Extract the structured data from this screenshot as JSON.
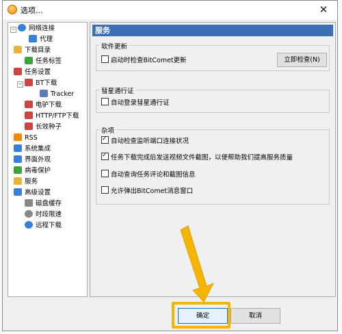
{
  "window": {
    "title": "选项...",
    "close_symbol": "✕"
  },
  "tree": [
    {
      "label": "网络连接",
      "icon": "globe-icon",
      "color": "#3a7fd6"
    },
    {
      "label": "代理",
      "icon": "proxy-icon",
      "color": "#3a7fd6"
    },
    {
      "label": "下载目录",
      "icon": "folder-icon",
      "color": "#e6b43c"
    },
    {
      "label": "任务标签",
      "icon": "tag-icon",
      "color": "#3ba33b"
    },
    {
      "label": "任务设置",
      "icon": "task-icon",
      "color": "#c44"
    },
    {
      "label": "BT下载",
      "icon": "bt-icon",
      "color": "#c44"
    },
    {
      "label": "Tracker",
      "icon": "tracker-icon",
      "color": "#5a7fb8"
    },
    {
      "label": "电驴下载",
      "icon": "ed2k-icon",
      "color": "#c44"
    },
    {
      "label": "HTTP/FTP下载",
      "icon": "http-icon",
      "color": "#c44"
    },
    {
      "label": "长效种子",
      "icon": "seed-icon",
      "color": "#c44"
    },
    {
      "label": "RSS",
      "icon": "rss-icon",
      "color": "#f08a00"
    },
    {
      "label": "系统集成",
      "icon": "integration-icon",
      "color": "#3a7fd6"
    },
    {
      "label": "界面外观",
      "icon": "appearance-icon",
      "color": "#3a7fd6"
    },
    {
      "label": "病毒保护",
      "icon": "shield-icon",
      "color": "#3ba33b"
    },
    {
      "label": "服务",
      "icon": "service-icon",
      "color": "#e6b43c"
    },
    {
      "label": "高级设置",
      "icon": "advanced-icon",
      "color": "#3a7fd6"
    },
    {
      "label": "磁盘缓存",
      "icon": "disk-icon",
      "color": "#888"
    },
    {
      "label": "时段限速",
      "icon": "clock-icon",
      "color": "#888"
    },
    {
      "label": "远程下载",
      "icon": "remote-icon",
      "color": "#3a7fd6"
    }
  ],
  "panel": {
    "header": "服务",
    "software_update": {
      "title": "软件更新",
      "auto_check_label": "启动时检查BitComet更新",
      "auto_check_checked": false,
      "check_now_label": "立即检查(N)"
    },
    "comet_pass": {
      "title": "彗星通行证",
      "auto_login_label": "自动登录彗星通行证",
      "auto_login_checked": false
    },
    "misc": {
      "title": "杂项",
      "items": [
        {
          "label": "自动检查监听端口连接状况",
          "checked": true
        },
        {
          "label": "任务下载完成后发送视频文件截图，以便帮助我们提高服务质量",
          "checked": true
        },
        {
          "label": "自动查询任务评论和截图信息",
          "checked": false
        },
        {
          "label": "允许弹出BitComet消息窗口",
          "checked": false
        }
      ]
    }
  },
  "footer": {
    "ok_label": "确定",
    "cancel_label": "取消"
  },
  "annotation": {
    "arrow_color": "#f5b400"
  }
}
